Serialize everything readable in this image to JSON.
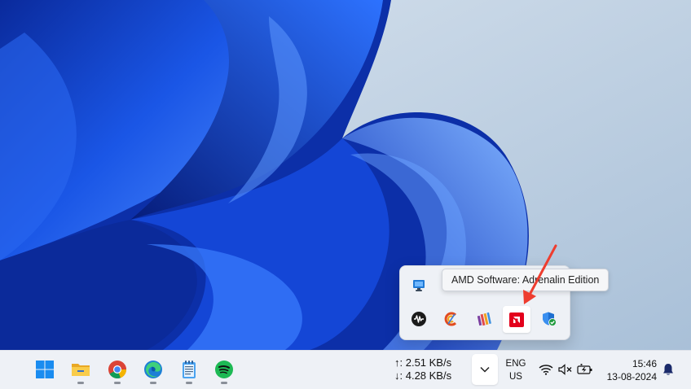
{
  "tooltip": {
    "text": "AMD Software: Adrenalin Edition"
  },
  "tray_flyout": {
    "icons": [
      "monitor-icon",
      "audio-wave-icon",
      "ccleaner-icon",
      "winrar-icon",
      "amd-icon",
      "windows-security-icon"
    ],
    "highlighted": "amd-icon"
  },
  "taskbar": {
    "apps": [
      "start-icon",
      "file-explorer-icon",
      "chrome-icon",
      "edge-icon",
      "notepad-icon",
      "spotify-icon"
    ],
    "network_speed": {
      "upload": "↑: 2.51 KB/s",
      "download": "↓: 4.28 KB/s"
    },
    "language": {
      "line1": "ENG",
      "line2": "US"
    },
    "clock": {
      "time": "15:46",
      "date": "13-08-2024"
    }
  },
  "colors": {
    "amd_red": "#e3001b",
    "arrow": "#ee3d2f",
    "accent": "#0a5cd6"
  }
}
